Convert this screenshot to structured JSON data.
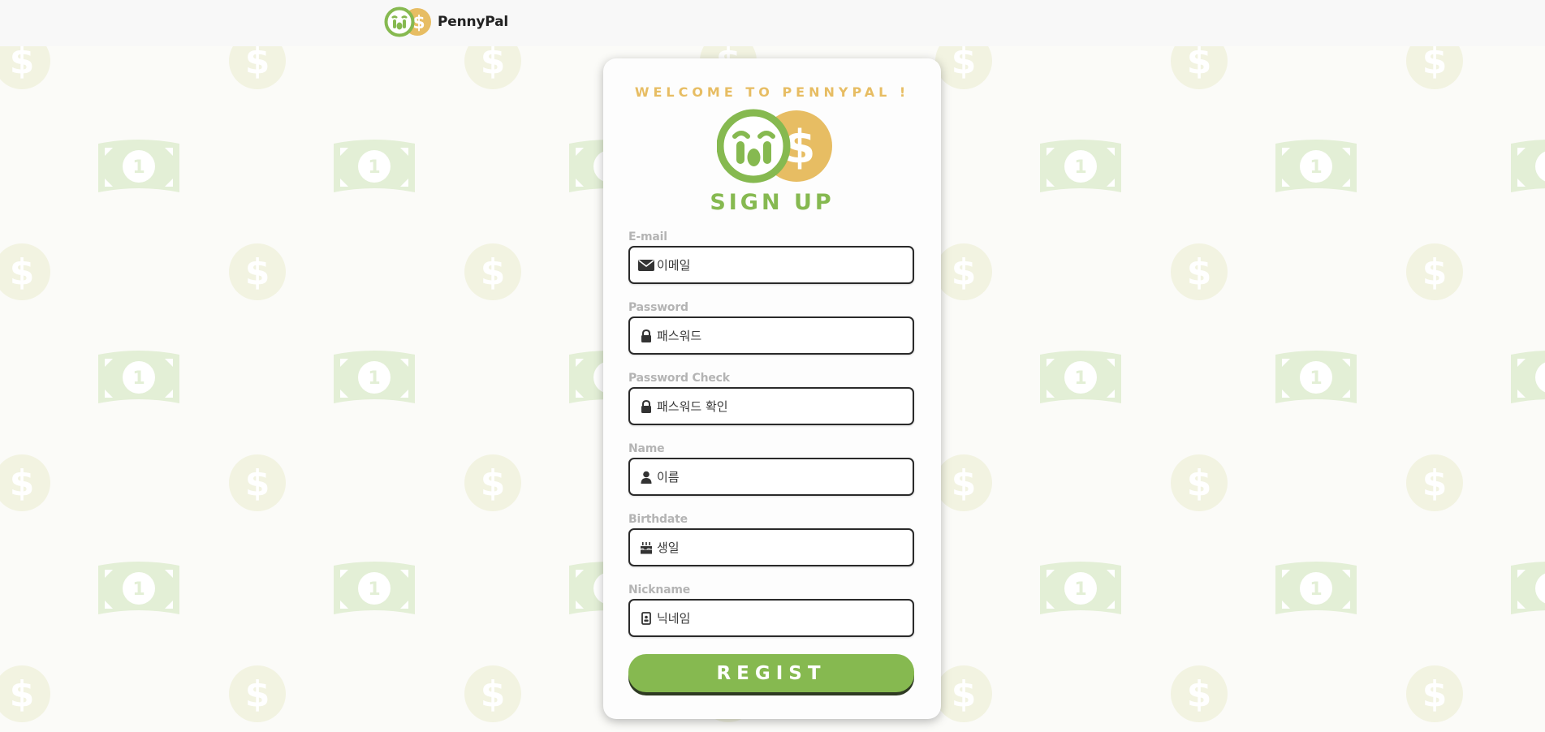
{
  "header": {
    "brand_name": "PennyPal",
    "logo_icon": "pennypal-logo-icon"
  },
  "colors": {
    "brand_green": "#86b950",
    "brand_yellow": "#e7bd63",
    "bg_green_tint": "#e3efd6",
    "bg_yellow_tint": "#f2f3e1",
    "label_gray": "#b4b4b4"
  },
  "card": {
    "welcome": "WELCOME TO PENNYPAL !",
    "title": "SIGN UP",
    "fields": [
      {
        "label": "E-mail",
        "placeholder": "이메일",
        "icon": "envelope-icon"
      },
      {
        "label": "Password",
        "placeholder": "패스워드",
        "icon": "lock-icon"
      },
      {
        "label": "Password Check",
        "placeholder": "패스워드 확인",
        "icon": "lock-icon"
      },
      {
        "label": "Name",
        "placeholder": "이름",
        "icon": "user-icon"
      },
      {
        "label": "Birthdate",
        "placeholder": "생일",
        "icon": "birthday-cake-icon"
      },
      {
        "label": "Nickname",
        "placeholder": "닉네임",
        "icon": "id-badge-icon"
      }
    ],
    "submit_label": "REGIST"
  },
  "background": {
    "pattern_icons": [
      "dollar-coin-icon",
      "banknote-icon"
    ]
  }
}
